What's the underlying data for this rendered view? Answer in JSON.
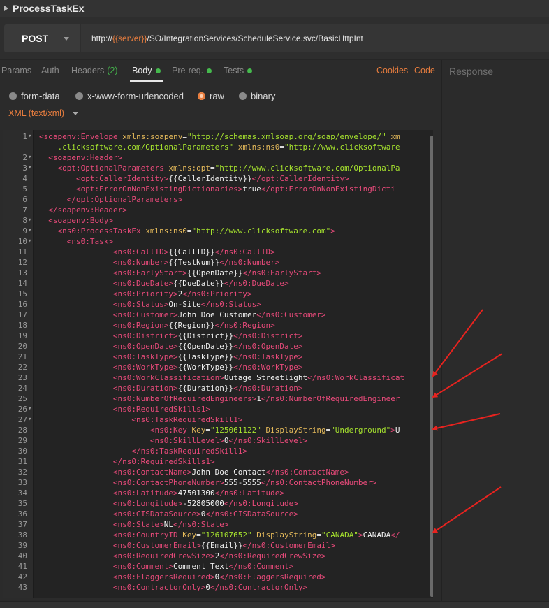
{
  "window": {
    "title": "ProcessTaskEx"
  },
  "request": {
    "method": "POST",
    "url_prefix": "http://",
    "url_variable": "{{server}}",
    "url_suffix": "/SO/IntegrationServices/ScheduleService.svc/BasicHttpInt"
  },
  "tabs": [
    {
      "label": "Params"
    },
    {
      "label": "Auth"
    },
    {
      "label": "Headers",
      "count": "(2)"
    },
    {
      "label": "Body"
    },
    {
      "label": "Pre-req."
    },
    {
      "label": "Tests"
    }
  ],
  "links": {
    "cookies": "Cookies",
    "code": "Code"
  },
  "response": {
    "label": "Response"
  },
  "body_types": [
    {
      "label": "form-data"
    },
    {
      "label": "x-www-form-urlencoded"
    },
    {
      "label": "raw"
    },
    {
      "label": "binary"
    }
  ],
  "language": "XML (text/xml)",
  "colors": {
    "accent": "#e87d3e",
    "active_dot": "#45b94d",
    "xml_tag": "#e84a7a",
    "xml_attr": "#e4b95a",
    "xml_value": "#a6e22e",
    "annotation_arrow": "#e8231f"
  },
  "code_lines": [
    {
      "n": "1",
      "fold": "▾",
      "indent": 0,
      "parts": [
        [
          "t",
          "<soapenv:Envelope "
        ],
        [
          "a",
          "xmlns:soapenv"
        ],
        [
          "x",
          "="
        ],
        [
          "v",
          "\"http://schemas.xmlsoap.org/soap/envelope/\""
        ],
        [
          "x",
          " "
        ],
        [
          "a",
          "xm"
        ]
      ]
    },
    {
      "n": "",
      "fold": "",
      "indent": 4,
      "parts": [
        [
          "v",
          ".clicksoftware.com/OptionalParameters\""
        ],
        [
          "x",
          " "
        ],
        [
          "a",
          "xmlns:ns0"
        ],
        [
          "x",
          "="
        ],
        [
          "v",
          "\"http://www.clicksoftware"
        ]
      ]
    },
    {
      "n": "2",
      "fold": "▾",
      "indent": 2,
      "parts": [
        [
          "t",
          "<soapenv:Header>"
        ]
      ]
    },
    {
      "n": "3",
      "fold": "▾",
      "indent": 4,
      "parts": [
        [
          "t",
          "<opt:OptionalParameters "
        ],
        [
          "a",
          "xmlns:opt"
        ],
        [
          "x",
          "="
        ],
        [
          "v",
          "\"http://www.clicksoftware.com/OptionalPa"
        ]
      ]
    },
    {
      "n": "4",
      "fold": "",
      "indent": 8,
      "parts": [
        [
          "t",
          "<opt:CallerIdentity>"
        ],
        [
          "x",
          "{{CallerIdentity}}"
        ],
        [
          "t",
          "</opt:CallerIdentity>"
        ]
      ]
    },
    {
      "n": "5",
      "fold": "",
      "indent": 8,
      "parts": [
        [
          "t",
          "<opt:ErrorOnNonExistingDictionaries>"
        ],
        [
          "x",
          "true"
        ],
        [
          "t",
          "</opt:ErrorOnNonExistingDicti"
        ]
      ]
    },
    {
      "n": "6",
      "fold": "",
      "indent": 6,
      "parts": [
        [
          "t",
          "</opt:OptionalParameters>"
        ]
      ]
    },
    {
      "n": "7",
      "fold": "",
      "indent": 2,
      "parts": [
        [
          "t",
          "</soapenv:Header>"
        ]
      ]
    },
    {
      "n": "8",
      "fold": "▾",
      "indent": 2,
      "parts": [
        [
          "t",
          "<soapenv:Body>"
        ]
      ]
    },
    {
      "n": "9",
      "fold": "▾",
      "indent": 4,
      "parts": [
        [
          "t",
          "<ns0:ProcessTaskEx "
        ],
        [
          "a",
          "xmlns:ns0"
        ],
        [
          "x",
          "="
        ],
        [
          "v",
          "\"http://www.clicksoftware.com\""
        ],
        [
          "t",
          ">"
        ]
      ]
    },
    {
      "n": "10",
      "fold": "▾",
      "indent": 6,
      "parts": [
        [
          "t",
          "<ns0:Task>"
        ]
      ]
    },
    {
      "n": "11",
      "fold": "",
      "indent": 16,
      "parts": [
        [
          "t",
          "<ns0:CallID>"
        ],
        [
          "x",
          "{{CallID}}"
        ],
        [
          "t",
          "</ns0:CallID>"
        ]
      ]
    },
    {
      "n": "12",
      "fold": "",
      "indent": 16,
      "parts": [
        [
          "t",
          "<ns0:Number>"
        ],
        [
          "x",
          "{{TestNum}}"
        ],
        [
          "t",
          "</ns0:Number>"
        ]
      ]
    },
    {
      "n": "13",
      "fold": "",
      "indent": 16,
      "parts": [
        [
          "t",
          "<ns0:EarlyStart>"
        ],
        [
          "x",
          "{{OpenDate}}"
        ],
        [
          "t",
          "</ns0:EarlyStart>"
        ]
      ]
    },
    {
      "n": "14",
      "fold": "",
      "indent": 16,
      "parts": [
        [
          "t",
          "<ns0:DueDate>"
        ],
        [
          "x",
          "{{DueDate}}"
        ],
        [
          "t",
          "</ns0:DueDate>"
        ]
      ]
    },
    {
      "n": "15",
      "fold": "",
      "indent": 16,
      "parts": [
        [
          "t",
          "<ns0:Priority>"
        ],
        [
          "x",
          "2"
        ],
        [
          "t",
          "</ns0:Priority>"
        ]
      ]
    },
    {
      "n": "16",
      "fold": "",
      "indent": 16,
      "parts": [
        [
          "t",
          "<ns0:Status>"
        ],
        [
          "x",
          "On-Site"
        ],
        [
          "t",
          "</ns0:Status>"
        ]
      ]
    },
    {
      "n": "17",
      "fold": "",
      "indent": 16,
      "parts": [
        [
          "t",
          "<ns0:Customer>"
        ],
        [
          "x",
          "John Doe Customer"
        ],
        [
          "t",
          "</ns0:Customer>"
        ]
      ]
    },
    {
      "n": "18",
      "fold": "",
      "indent": 16,
      "parts": [
        [
          "t",
          "<ns0:Region>"
        ],
        [
          "x",
          "{{Region}}"
        ],
        [
          "t",
          "</ns0:Region>"
        ]
      ]
    },
    {
      "n": "19",
      "fold": "",
      "indent": 16,
      "parts": [
        [
          "t",
          "<ns0:District>"
        ],
        [
          "x",
          "{{District}}"
        ],
        [
          "t",
          "</ns0:District>"
        ]
      ]
    },
    {
      "n": "20",
      "fold": "",
      "indent": 16,
      "parts": [
        [
          "t",
          "<ns0:OpenDate>"
        ],
        [
          "x",
          "{{OpenDate}}"
        ],
        [
          "t",
          "</ns0:OpenDate>"
        ]
      ]
    },
    {
      "n": "21",
      "fold": "",
      "indent": 16,
      "parts": [
        [
          "t",
          "<ns0:TaskType>"
        ],
        [
          "x",
          "{{TaskType}}"
        ],
        [
          "t",
          "</ns0:TaskType>"
        ]
      ]
    },
    {
      "n": "22",
      "fold": "",
      "indent": 16,
      "parts": [
        [
          "t",
          "<ns0:WorkType>"
        ],
        [
          "x",
          "{{WorkType}}"
        ],
        [
          "t",
          "</ns0:WorkType>"
        ]
      ]
    },
    {
      "n": "23",
      "fold": "",
      "indent": 16,
      "parts": [
        [
          "t",
          "<ns0:WorkClassification>"
        ],
        [
          "x",
          "Outage Streetlight"
        ],
        [
          "t",
          "</ns0:WorkClassificat"
        ]
      ]
    },
    {
      "n": "24",
      "fold": "",
      "indent": 16,
      "parts": [
        [
          "t",
          "<ns0:Duration>"
        ],
        [
          "x",
          "{{Duration}}"
        ],
        [
          "t",
          "</ns0:Duration>"
        ]
      ]
    },
    {
      "n": "25",
      "fold": "",
      "indent": 16,
      "parts": [
        [
          "t",
          "<ns0:NumberOfRequiredEngineers>"
        ],
        [
          "x",
          "1"
        ],
        [
          "t",
          "</ns0:NumberOfRequiredEngineer"
        ]
      ]
    },
    {
      "n": "26",
      "fold": "▾",
      "indent": 16,
      "parts": [
        [
          "t",
          "<ns0:RequiredSkills1>"
        ]
      ]
    },
    {
      "n": "27",
      "fold": "▾",
      "indent": 20,
      "parts": [
        [
          "t",
          "<ns0:TaskRequiredSkill1>"
        ]
      ]
    },
    {
      "n": "28",
      "fold": "",
      "indent": 24,
      "parts": [
        [
          "t",
          "<ns0:Key "
        ],
        [
          "a",
          "Key"
        ],
        [
          "x",
          "="
        ],
        [
          "v",
          "\"125061122\""
        ],
        [
          "x",
          " "
        ],
        [
          "a",
          "DisplayString"
        ],
        [
          "x",
          "="
        ],
        [
          "v",
          "\"Underground\""
        ],
        [
          "t",
          ">"
        ],
        [
          "x",
          "U"
        ]
      ]
    },
    {
      "n": "29",
      "fold": "",
      "indent": 24,
      "parts": [
        [
          "t",
          "<ns0:SkillLevel>"
        ],
        [
          "x",
          "0"
        ],
        [
          "t",
          "</ns0:SkillLevel>"
        ]
      ]
    },
    {
      "n": "30",
      "fold": "",
      "indent": 20,
      "parts": [
        [
          "t",
          "</ns0:TaskRequiredSkill1>"
        ]
      ]
    },
    {
      "n": "31",
      "fold": "",
      "indent": 16,
      "parts": [
        [
          "t",
          "</ns0:RequiredSkills1>"
        ]
      ]
    },
    {
      "n": "32",
      "fold": "",
      "indent": 16,
      "parts": [
        [
          "t",
          "<ns0:ContactName>"
        ],
        [
          "x",
          "John Doe Contact"
        ],
        [
          "t",
          "</ns0:ContactName>"
        ]
      ]
    },
    {
      "n": "33",
      "fold": "",
      "indent": 16,
      "parts": [
        [
          "t",
          "<ns0:ContactPhoneNumber>"
        ],
        [
          "x",
          "555-5555"
        ],
        [
          "t",
          "</ns0:ContactPhoneNumber>"
        ]
      ]
    },
    {
      "n": "34",
      "fold": "",
      "indent": 16,
      "parts": [
        [
          "t",
          "<ns0:Latitude>"
        ],
        [
          "x",
          "47501300"
        ],
        [
          "t",
          "</ns0:Latitude>"
        ]
      ]
    },
    {
      "n": "35",
      "fold": "",
      "indent": 16,
      "parts": [
        [
          "t",
          "<ns0:Longitude>"
        ],
        [
          "x",
          "-52805000"
        ],
        [
          "t",
          "</ns0:Longitude>"
        ]
      ]
    },
    {
      "n": "36",
      "fold": "",
      "indent": 16,
      "parts": [
        [
          "t",
          "<ns0:GISDataSource>"
        ],
        [
          "x",
          "0"
        ],
        [
          "t",
          "</ns0:GISDataSource>"
        ]
      ]
    },
    {
      "n": "37",
      "fold": "",
      "indent": 16,
      "parts": [
        [
          "t",
          "<ns0:State>"
        ],
        [
          "x",
          "NL"
        ],
        [
          "t",
          "</ns0:State>"
        ]
      ]
    },
    {
      "n": "38",
      "fold": "",
      "indent": 16,
      "parts": [
        [
          "t",
          "<ns0:CountryID "
        ],
        [
          "a",
          "Key"
        ],
        [
          "x",
          "="
        ],
        [
          "v",
          "\"126107652\""
        ],
        [
          "x",
          " "
        ],
        [
          "a",
          "DisplayString"
        ],
        [
          "x",
          "="
        ],
        [
          "v",
          "\"CANADA\""
        ],
        [
          "t",
          ">"
        ],
        [
          "x",
          "CANADA"
        ],
        [
          "t",
          "</"
        ]
      ]
    },
    {
      "n": "39",
      "fold": "",
      "indent": 16,
      "parts": [
        [
          "t",
          "<ns0:CustomerEmail>"
        ],
        [
          "x",
          "{{Email}}"
        ],
        [
          "t",
          "</ns0:CustomerEmail>"
        ]
      ]
    },
    {
      "n": "40",
      "fold": "",
      "indent": 16,
      "parts": [
        [
          "t",
          "<ns0:RequiredCrewSize>"
        ],
        [
          "x",
          "2"
        ],
        [
          "t",
          "</ns0:RequiredCrewSize>"
        ]
      ]
    },
    {
      "n": "41",
      "fold": "",
      "indent": 16,
      "parts": [
        [
          "t",
          "<ns0:Comment>"
        ],
        [
          "x",
          "Comment Text"
        ],
        [
          "t",
          "</ns0:Comment>"
        ]
      ]
    },
    {
      "n": "42",
      "fold": "",
      "indent": 16,
      "parts": [
        [
          "t",
          "<ns0:FlaggersRequired>"
        ],
        [
          "x",
          "0"
        ],
        [
          "t",
          "</ns0:FlaggersRequired>"
        ]
      ]
    },
    {
      "n": "43",
      "fold": "",
      "indent": 16,
      "parts": [
        [
          "t",
          "<ns0:ContractorOnly>"
        ],
        [
          "x",
          "0"
        ],
        [
          "t",
          "</ns0:ContractorOnly>"
        ]
      ]
    }
  ]
}
